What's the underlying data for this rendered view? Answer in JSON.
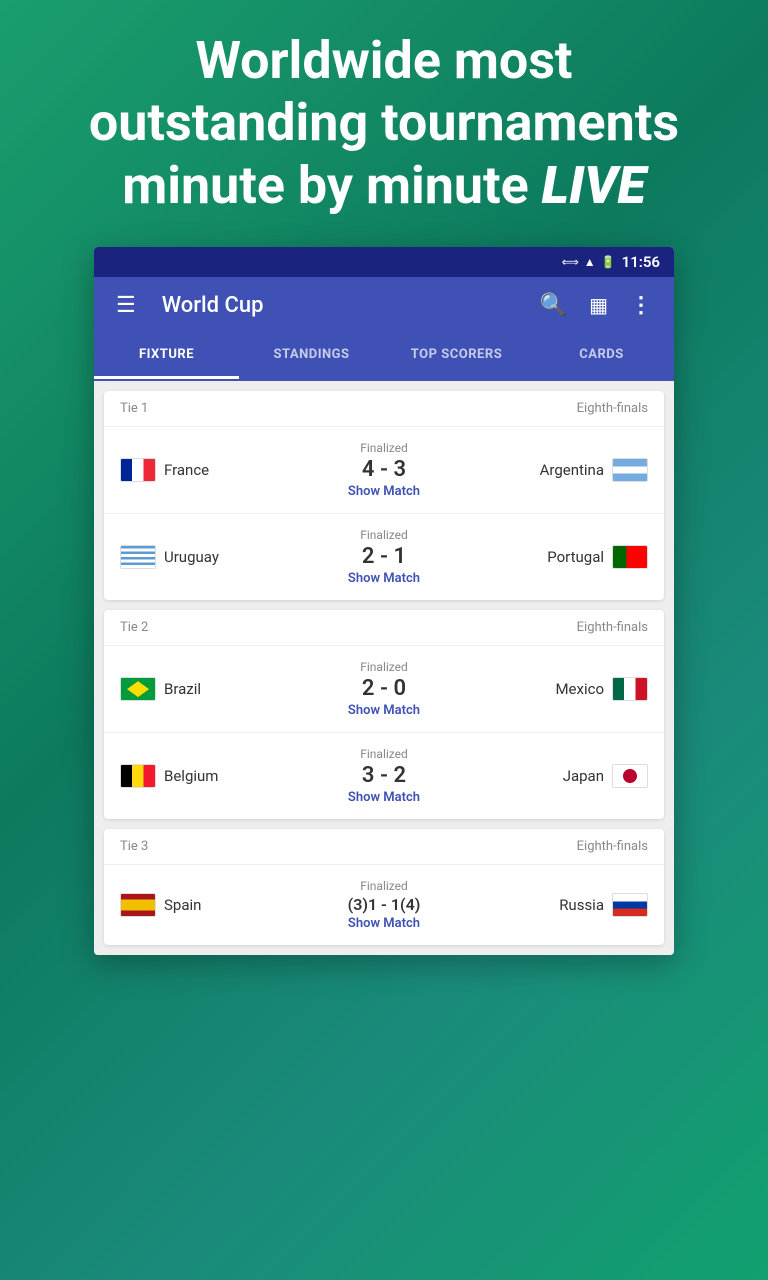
{
  "hero": {
    "line1": "Worldwide most outstanding tournaments",
    "line2": "minute by minute",
    "line2_emphasis": "LIVE"
  },
  "status_bar": {
    "time": "11:56",
    "icons": [
      "signal",
      "battery"
    ]
  },
  "app_bar": {
    "title": "World Cup",
    "menu_icon": "☰",
    "search_icon": "⌕",
    "calendar_icon": "▦",
    "more_icon": "⋮"
  },
  "tabs": [
    {
      "label": "FIXTURE",
      "active": true
    },
    {
      "label": "STANDINGS",
      "active": false
    },
    {
      "label": "TOP SCORERS",
      "active": false
    },
    {
      "label": "CARDS",
      "active": false
    }
  ],
  "ties": [
    {
      "id": "Tie  1",
      "stage": "Eighth-finals",
      "matches": [
        {
          "team_left": "France",
          "flag_left": "france",
          "status": "Finalized",
          "score": "4 - 3",
          "show_match": "Show Match",
          "team_right": "Argentina",
          "flag_right": "argentina"
        },
        {
          "team_left": "Uruguay",
          "flag_left": "uruguay",
          "status": "Finalized",
          "score": "2 - 1",
          "show_match": "Show Match",
          "team_right": "Portugal",
          "flag_right": "portugal"
        }
      ]
    },
    {
      "id": "Tie  2",
      "stage": "Eighth-finals",
      "matches": [
        {
          "team_left": "Brazil",
          "flag_left": "brazil",
          "status": "Finalized",
          "score": "2 - 0",
          "show_match": "Show Match",
          "team_right": "Mexico",
          "flag_right": "mexico"
        },
        {
          "team_left": "Belgium",
          "flag_left": "belgium",
          "status": "Finalized",
          "score": "3 - 2",
          "show_match": "Show Match",
          "team_right": "Japan",
          "flag_right": "japan"
        }
      ]
    },
    {
      "id": "Tie  3",
      "stage": "Eighth-finals",
      "matches": [
        {
          "team_left": "Spain",
          "flag_left": "spain",
          "status": "Finalized",
          "score": "(3)1 - 1(4)",
          "show_match": "Show Match",
          "team_right": "Russia",
          "flag_right": "russia"
        }
      ]
    }
  ]
}
